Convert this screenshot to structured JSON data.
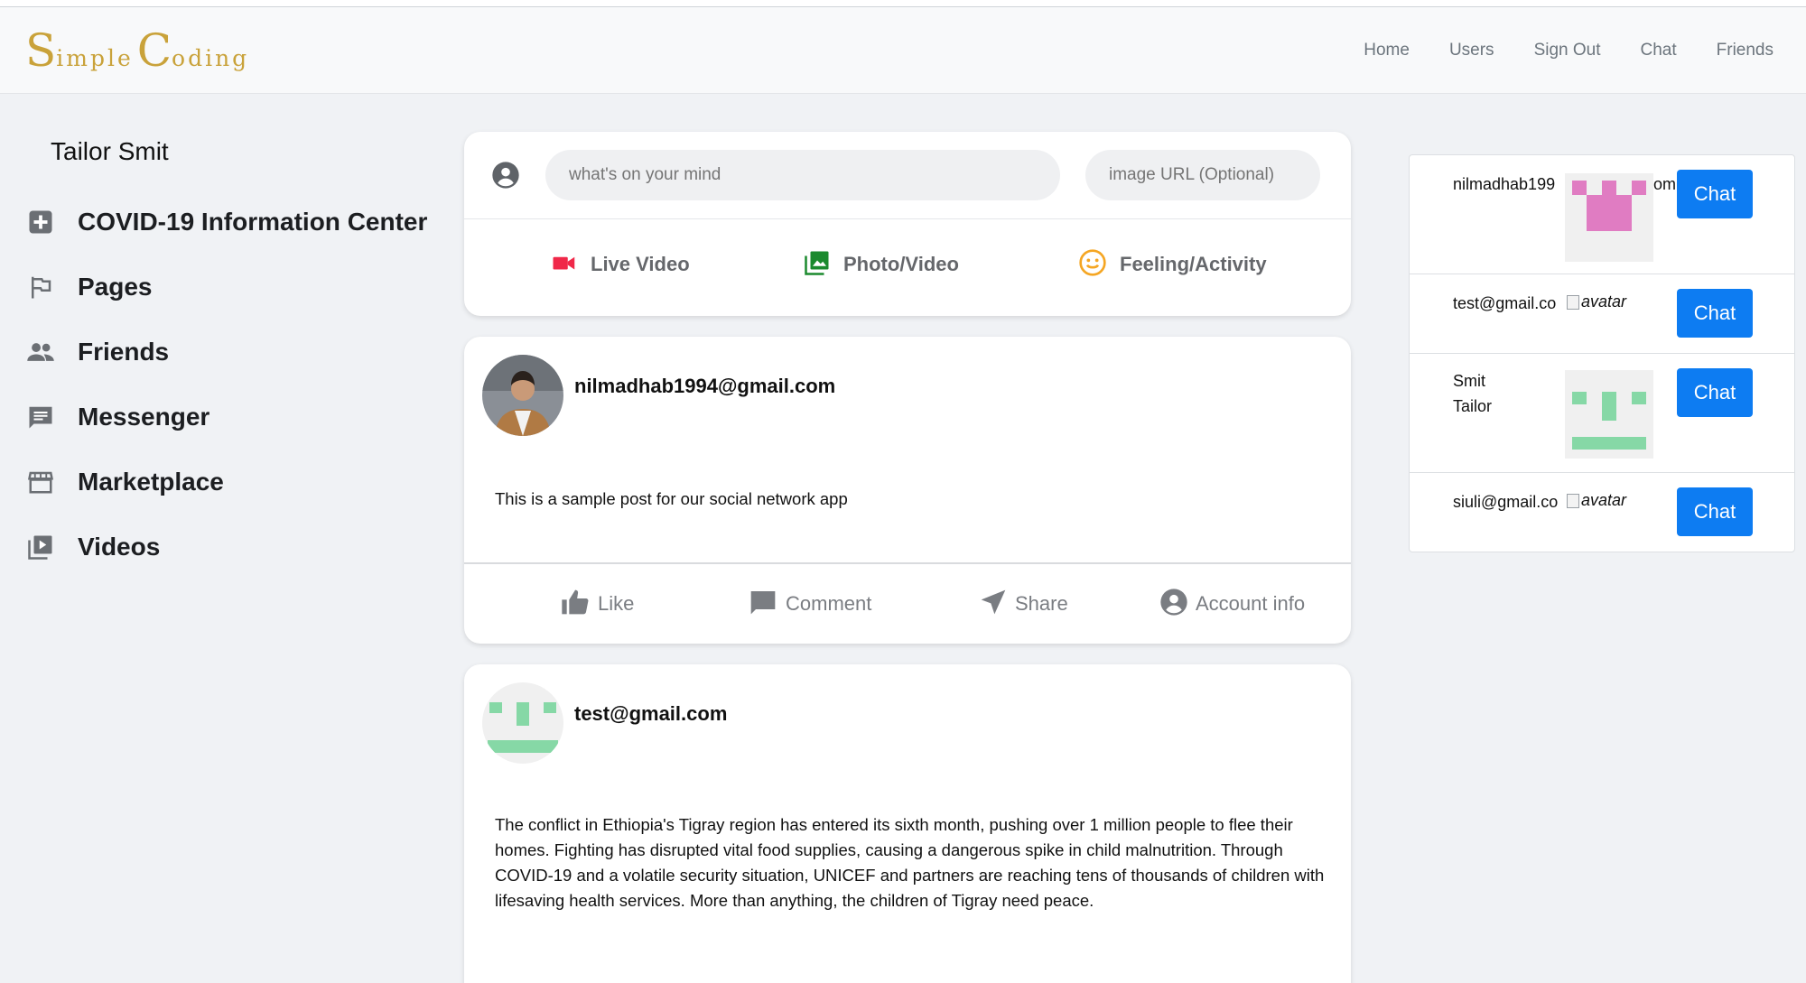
{
  "brand": {
    "first_big": "S",
    "first_small": "imple",
    "second_big": "C",
    "second_small": "oding"
  },
  "nav": {
    "links": [
      "Home",
      "Users",
      "Sign Out",
      "Chat",
      "Friends"
    ]
  },
  "sidebar": {
    "user_name": "Tailor Smit",
    "items": [
      {
        "label": "COVID-19 Information Center",
        "icon": "plus-box-icon"
      },
      {
        "label": "Pages",
        "icon": "flag-icon"
      },
      {
        "label": "Friends",
        "icon": "people-icon"
      },
      {
        "label": "Messenger",
        "icon": "chat-bubble-icon"
      },
      {
        "label": "Marketplace",
        "icon": "store-icon"
      },
      {
        "label": "Videos",
        "icon": "video-library-icon"
      }
    ]
  },
  "composer": {
    "mind_placeholder": "what's on your mind",
    "url_placeholder": "image URL (Optional)",
    "options": [
      {
        "label": "Live Video",
        "icon": "videocam-icon",
        "color": "#f02849"
      },
      {
        "label": "Photo/Video",
        "icon": "photo-library-icon",
        "color": "#1b8a2e"
      },
      {
        "label": "Feeling/Activity",
        "icon": "smiley-icon",
        "color": "#f5a623"
      }
    ]
  },
  "posts": [
    {
      "author": "nilmadhab1994@gmail.com",
      "text": "This is a sample post for our social network app",
      "actions": [
        "Like",
        "Comment",
        "Share",
        "Account info"
      ]
    },
    {
      "author": "test@gmail.com",
      "text": "The conflict in Ethiopia's Tigray region has entered its sixth month, pushing over 1 million people to flee their homes. Fighting has disrupted vital food supplies, causing a dangerous spike in child malnutrition. Through COVID-19 and a volatile security situation, UNICEF and partners are reaching tens of thousands of children with lifesaving health services. More than anything, the children of Tigray need peace."
    }
  ],
  "users": {
    "chat_label": "Chat",
    "list": [
      {
        "name_left": "nilmadhab199",
        "name_right": "om"
      },
      {
        "name": "test@gmail.co",
        "avatar_alt": "avatar"
      },
      {
        "name_line1": "Smit",
        "name_line2": "Tailor"
      },
      {
        "name": "siuli@gmail.co",
        "avatar_alt": "avatar"
      }
    ]
  },
  "colors": {
    "brand_gold": "#c9a23a",
    "chat_button": "#0d7cf2",
    "identicon_pink": "#e07cc2",
    "identicon_green": "#86d8a6"
  }
}
